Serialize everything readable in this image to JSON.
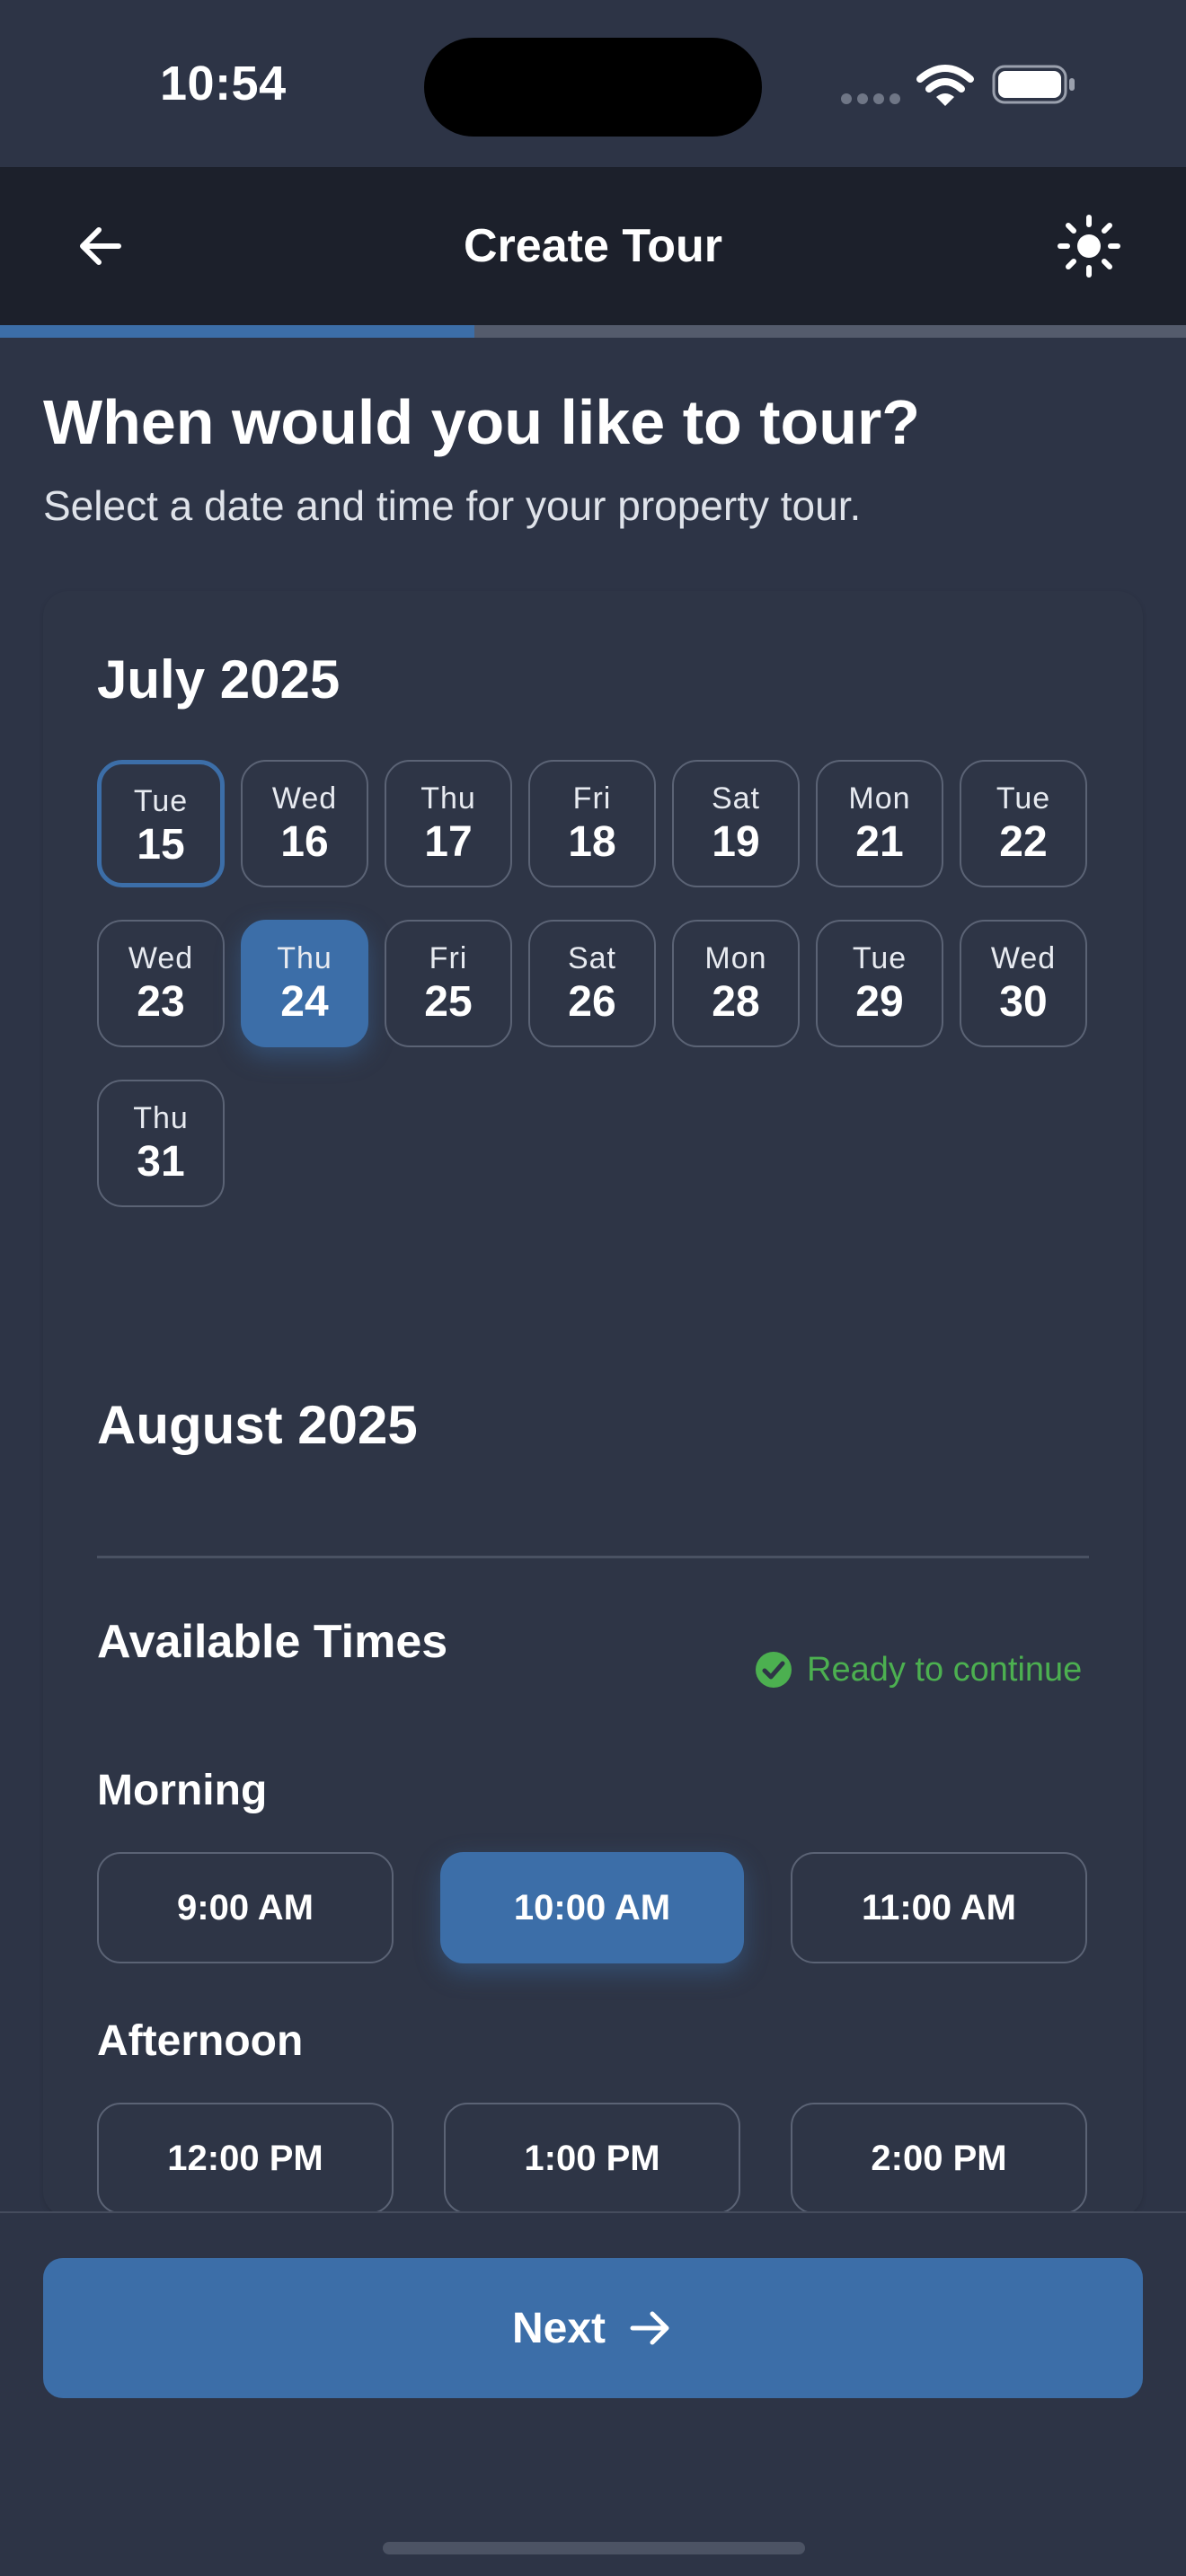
{
  "status_bar": {
    "time": "10:54"
  },
  "nav": {
    "title": "Create Tour",
    "back_icon": "arrow-left-icon",
    "theme_icon": "sun-icon"
  },
  "progress": {
    "fraction": 0.4
  },
  "heading": {
    "title": "When would you like to tour?",
    "subtitle": "Select a date and time for your property tour."
  },
  "calendar": {
    "months": [
      {
        "title": "July 2025",
        "dates": [
          {
            "dow": "Tue",
            "day": "15",
            "state": "today"
          },
          {
            "dow": "Wed",
            "day": "16",
            "state": ""
          },
          {
            "dow": "Thu",
            "day": "17",
            "state": ""
          },
          {
            "dow": "Fri",
            "day": "18",
            "state": ""
          },
          {
            "dow": "Sat",
            "day": "19",
            "state": ""
          },
          {
            "dow": "Mon",
            "day": "21",
            "state": ""
          },
          {
            "dow": "Tue",
            "day": "22",
            "state": ""
          },
          {
            "dow": "Wed",
            "day": "23",
            "state": ""
          },
          {
            "dow": "Thu",
            "day": "24",
            "state": "selected"
          },
          {
            "dow": "Fri",
            "day": "25",
            "state": ""
          },
          {
            "dow": "Sat",
            "day": "26",
            "state": ""
          },
          {
            "dow": "Mon",
            "day": "28",
            "state": ""
          },
          {
            "dow": "Tue",
            "day": "29",
            "state": ""
          },
          {
            "dow": "Wed",
            "day": "30",
            "state": ""
          },
          {
            "dow": "Thu",
            "day": "31",
            "state": ""
          }
        ]
      },
      {
        "title": "August 2025",
        "dates": []
      }
    ]
  },
  "times": {
    "title": "Available Times",
    "status": "Ready to continue",
    "status_color": "#4cb050",
    "periods": [
      {
        "label": "Morning",
        "slots": [
          {
            "label": "9:00 AM",
            "selected": false
          },
          {
            "label": "10:00 AM",
            "selected": true
          },
          {
            "label": "11:00 AM",
            "selected": false
          }
        ]
      },
      {
        "label": "Afternoon",
        "slots": [
          {
            "label": "12:00 PM",
            "selected": false
          },
          {
            "label": "1:00 PM",
            "selected": false
          },
          {
            "label": "2:00 PM",
            "selected": false
          }
        ]
      }
    ]
  },
  "footer": {
    "next_label": "Next",
    "next_icon": "arrow-right-icon"
  },
  "colors": {
    "accent": "#3c6ea8",
    "background": "#2d3446",
    "nav_background": "#1c202b",
    "success": "#4cb050"
  }
}
